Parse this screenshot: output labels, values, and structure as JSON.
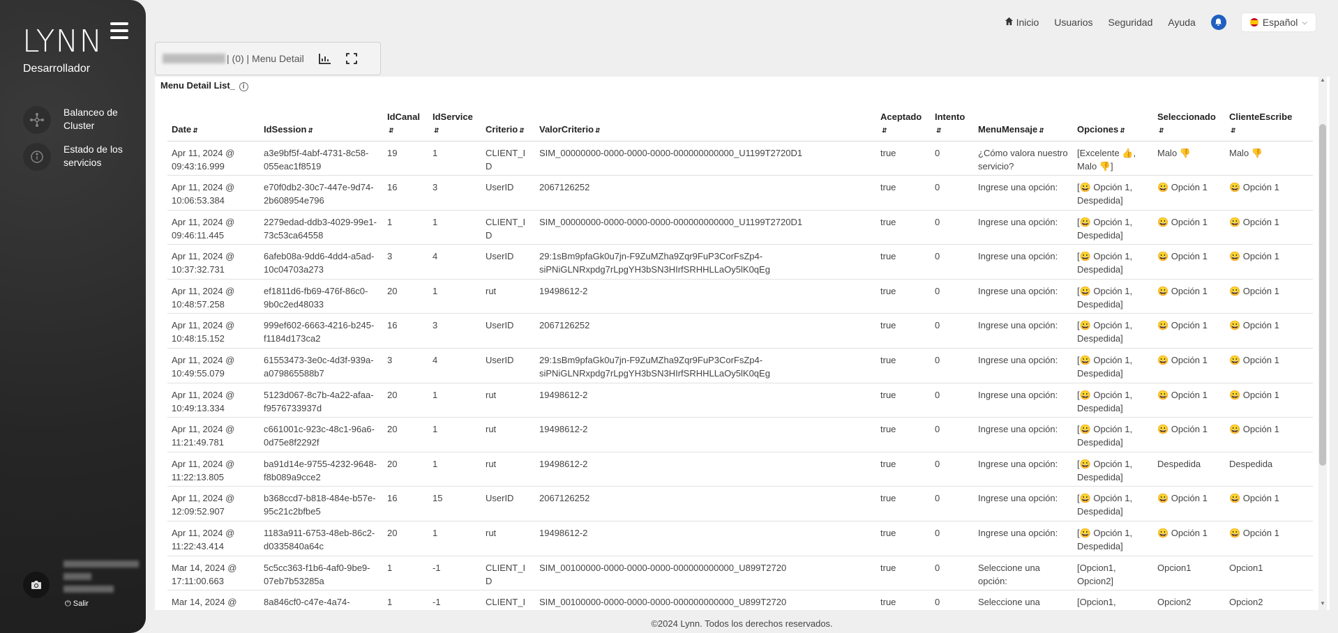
{
  "brand": {
    "logo": "LYNN",
    "role": "Desarrollador"
  },
  "sidebar": {
    "items": [
      {
        "label": "Balanceo de Cluster",
        "icon": "network-icon"
      },
      {
        "label": "Estado de los servicios",
        "icon": "info-icon"
      }
    ],
    "logout": "Salir"
  },
  "topnav": {
    "home": "Inicio",
    "users": "Usuarios",
    "security": "Seguridad",
    "help": "Ayuda",
    "language": "Español"
  },
  "breadcrumb": {
    "text": "| (0) | Menu Detail"
  },
  "panel": {
    "title": "Menu Detail List_"
  },
  "table": {
    "columns": [
      "Date",
      "IdSession",
      "IdCanal",
      "IdService",
      "Criterio",
      "ValorCriterio",
      "Aceptado",
      "Intento",
      "MenuMensaje",
      "Opciones",
      "Seleccionado",
      "ClienteEscribe"
    ],
    "rows": [
      [
        "Apr 11, 2024 @ 09:43:16.999",
        "a3e9bf5f-4abf-4731-8c58-055eac1f8519",
        "19",
        "1",
        "CLIENT_ID",
        "SIM_00000000-0000-0000-0000-000000000000_U1199T2720D1",
        "true",
        "0",
        "¿Cómo valora nuestro servicio?",
        "[Excelente 👍, Malo 👎]",
        "Malo 👎",
        "Malo 👎"
      ],
      [
        "Apr 11, 2024 @ 10:06:53.384",
        "e70f0db2-30c7-447e-9d74-2b608954e796",
        "16",
        "3",
        "UserID",
        "2067126252",
        "true",
        "0",
        "Ingrese una opción:",
        "[😀 Opción 1, Despedida]",
        "😀 Opción 1",
        "😀 Opción 1"
      ],
      [
        "Apr 11, 2024 @ 09:46:11.445",
        "2279edad-ddb3-4029-99e1-73c53ca64558",
        "1",
        "1",
        "CLIENT_ID",
        "SIM_00000000-0000-0000-0000-000000000000_U1199T2720D1",
        "true",
        "0",
        "Ingrese una opción:",
        "[😀 Opción 1, Despedida]",
        "😀 Opción 1",
        "😀 Opción 1"
      ],
      [
        "Apr 11, 2024 @ 10:37:32.731",
        "6afeb08a-9dd6-4dd4-a5ad-10c04703a273",
        "3",
        "4",
        "UserID",
        "29:1sBm9pfaGk0u7jn-F9ZuMZha9Zqr9FuP3CorFsZp4-siPNiGLNRxpdg7rLpgYH3bSN3HIrfSRHHLLaOy5lK0qEg",
        "true",
        "0",
        "Ingrese una opción:",
        "[😀 Opción 1, Despedida]",
        "😀 Opción 1",
        "😀 Opción 1"
      ],
      [
        "Apr 11, 2024 @ 10:48:57.258",
        "ef1811d6-fb69-476f-86c0-9b0c2ed48033",
        "20",
        "1",
        "rut",
        "19498612-2",
        "true",
        "0",
        "Ingrese una opción:",
        "[😀 Opción 1, Despedida]",
        "😀 Opción 1",
        "😀 Opción 1"
      ],
      [
        "Apr 11, 2024 @ 10:48:15.152",
        "999ef602-6663-4216-b245-f1184d173ca2",
        "16",
        "3",
        "UserID",
        "2067126252",
        "true",
        "0",
        "Ingrese una opción:",
        "[😀 Opción 1, Despedida]",
        "😀 Opción 1",
        "😀 Opción 1"
      ],
      [
        "Apr 11, 2024 @ 10:49:55.079",
        "61553473-3e0c-4d3f-939a-a079865588b7",
        "3",
        "4",
        "UserID",
        "29:1sBm9pfaGk0u7jn-F9ZuMZha9Zqr9FuP3CorFsZp4-siPNiGLNRxpdg7rLpgYH3bSN3HIrfSRHHLLaOy5lK0qEg",
        "true",
        "0",
        "Ingrese una opción:",
        "[😀 Opción 1, Despedida]",
        "😀 Opción 1",
        "😀 Opción 1"
      ],
      [
        "Apr 11, 2024 @ 10:49:13.334",
        "5123d067-8c7b-4a22-afaa-f9576733937d",
        "20",
        "1",
        "rut",
        "19498612-2",
        "true",
        "0",
        "Ingrese una opción:",
        "[😀 Opción 1, Despedida]",
        "😀 Opción 1",
        "😀 Opción 1"
      ],
      [
        "Apr 11, 2024 @ 11:21:49.781",
        "c661001c-923c-48c1-96a6-0d75e8f2292f",
        "20",
        "1",
        "rut",
        "19498612-2",
        "true",
        "0",
        "Ingrese una opción:",
        "[😀 Opción 1, Despedida]",
        "😀 Opción 1",
        "😀 Opción 1"
      ],
      [
        "Apr 11, 2024 @ 11:22:13.805",
        "ba91d14e-9755-4232-9648-f8b089a9cce2",
        "20",
        "1",
        "rut",
        "19498612-2",
        "true",
        "0",
        "Ingrese una opción:",
        "[😀 Opción 1, Despedida]",
        "Despedida",
        "Despedida"
      ],
      [
        "Apr 11, 2024 @ 12:09:52.907",
        "b368ccd7-b818-484e-b57e-95c21c2bfbe5",
        "16",
        "15",
        "UserID",
        "2067126252",
        "true",
        "0",
        "Ingrese una opción:",
        "[😀 Opción 1, Despedida]",
        "😀 Opción 1",
        "😀 Opción 1"
      ],
      [
        "Apr 11, 2024 @ 11:22:43.414",
        "1183a911-6753-48eb-86c2-d0335840a64c",
        "20",
        "1",
        "rut",
        "19498612-2",
        "true",
        "0",
        "Ingrese una opción:",
        "[😀 Opción 1, Despedida]",
        "😀 Opción 1",
        "😀 Opción 1"
      ],
      [
        "Mar 14, 2024 @ 17:11:00.663",
        "5c5cc363-f1b6-4af0-9be9-07eb7b53285a",
        "1",
        "-1",
        "CLIENT_ID",
        "SIM_00100000-0000-0000-0000-000000000000_U899T2720",
        "true",
        "0",
        "Seleccione una opción:",
        "[Opcion1, Opcion2]",
        "Opcion1",
        "Opcion1"
      ],
      [
        "Mar 14, 2024 @",
        "8a846cf0-c47e-4a74-",
        "1",
        "-1",
        "CLIENT_ID",
        "SIM_00100000-0000-0000-0000-000000000000_U899T2720",
        "true",
        "0",
        "Seleccione una",
        "[Opcion1,",
        "Opcion2",
        "Opcion2"
      ]
    ]
  },
  "footer": "©2024 Lynn. Todos los derechos reservados."
}
